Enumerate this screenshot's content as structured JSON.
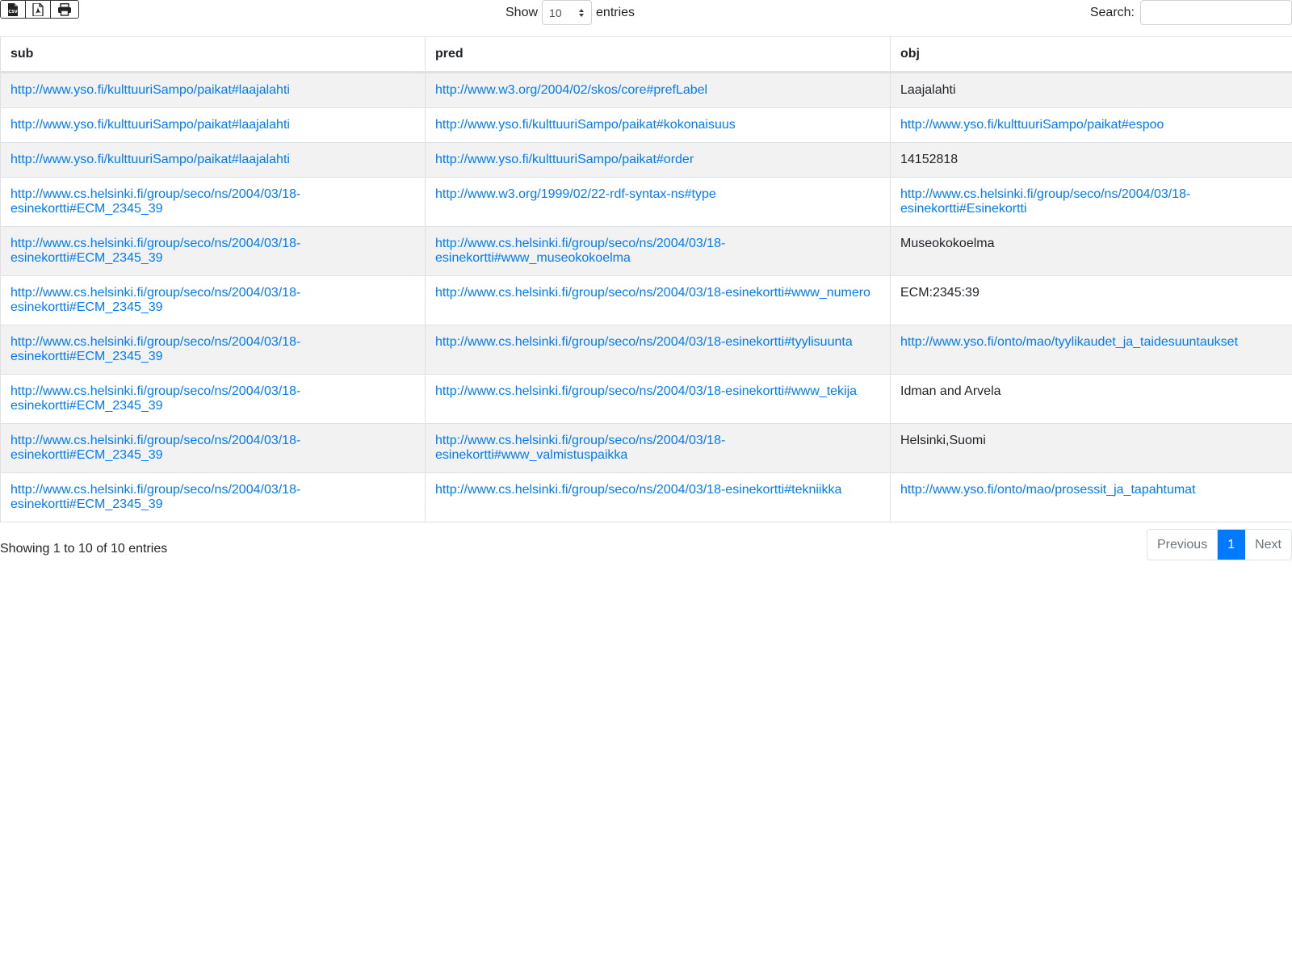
{
  "toolbar": {
    "export_buttons": [
      {
        "icon": "csv-file-icon"
      },
      {
        "icon": "pdf-file-icon"
      },
      {
        "icon": "print-icon"
      }
    ],
    "show_label": "Show",
    "page_length_value": "10",
    "entries_label": "entries",
    "search_label": "Search:",
    "search_value": ""
  },
  "table": {
    "columns": [
      "sub",
      "pred",
      "obj"
    ],
    "rows": [
      {
        "sub": "http://www.yso.fi/kulttuuriSampo/paikat#laajalahti",
        "pred": "http://www.w3.org/2004/02/skos/core#prefLabel",
        "obj": "Laajalahti",
        "obj_is_link": false
      },
      {
        "sub": "http://www.yso.fi/kulttuuriSampo/paikat#laajalahti",
        "pred": "http://www.yso.fi/kulttuuriSampo/paikat#kokonaisuus",
        "obj": "http://www.yso.fi/kulttuuriSampo/paikat#espoo",
        "obj_is_link": true
      },
      {
        "sub": "http://www.yso.fi/kulttuuriSampo/paikat#laajalahti",
        "pred": "http://www.yso.fi/kulttuuriSampo/paikat#order",
        "obj": "14152818",
        "obj_is_link": false
      },
      {
        "sub": "http://www.cs.helsinki.fi/group/seco/ns/2004/03/18-esinekortti#ECM_2345_39",
        "pred": "http://www.w3.org/1999/02/22-rdf-syntax-ns#type",
        "obj": "http://www.cs.helsinki.fi/group/seco/ns/2004/03/18-esinekortti#Esinekortti",
        "obj_is_link": true
      },
      {
        "sub": "http://www.cs.helsinki.fi/group/seco/ns/2004/03/18-esinekortti#ECM_2345_39",
        "pred": "http://www.cs.helsinki.fi/group/seco/ns/2004/03/18-esinekortti#www_museokokoelma",
        "obj": "Museokokoelma",
        "obj_is_link": false
      },
      {
        "sub": "http://www.cs.helsinki.fi/group/seco/ns/2004/03/18-esinekortti#ECM_2345_39",
        "pred": "http://www.cs.helsinki.fi/group/seco/ns/2004/03/18-esinekortti#www_numero",
        "obj": "ECM:2345:39",
        "obj_is_link": false
      },
      {
        "sub": "http://www.cs.helsinki.fi/group/seco/ns/2004/03/18-esinekortti#ECM_2345_39",
        "pred": "http://www.cs.helsinki.fi/group/seco/ns/2004/03/18-esinekortti#tyylisuunta",
        "obj": "http://www.yso.fi/onto/mao/tyylikaudet_ja_taidesuuntaukset",
        "obj_is_link": true
      },
      {
        "sub": "http://www.cs.helsinki.fi/group/seco/ns/2004/03/18-esinekortti#ECM_2345_39",
        "pred": "http://www.cs.helsinki.fi/group/seco/ns/2004/03/18-esinekortti#www_tekija",
        "obj": "Idman and Arvela",
        "obj_is_link": false
      },
      {
        "sub": "http://www.cs.helsinki.fi/group/seco/ns/2004/03/18-esinekortti#ECM_2345_39",
        "pred": "http://www.cs.helsinki.fi/group/seco/ns/2004/03/18-esinekortti#www_valmistuspaikka",
        "obj": "Helsinki,Suomi",
        "obj_is_link": false
      },
      {
        "sub": "http://www.cs.helsinki.fi/group/seco/ns/2004/03/18-esinekortti#ECM_2345_39",
        "pred": "http://www.cs.helsinki.fi/group/seco/ns/2004/03/18-esinekortti#tekniikka",
        "obj": "http://www.yso.fi/onto/mao/prosessit_ja_tapahtumat",
        "obj_is_link": true
      }
    ]
  },
  "footer": {
    "info": "Showing 1 to 10 of 10 entries",
    "previous_label": "Previous",
    "current_page": "1",
    "next_label": "Next"
  },
  "colors": {
    "link": "#007bff",
    "active_page": "#007bff",
    "stripe": "#f2f2f2"
  }
}
